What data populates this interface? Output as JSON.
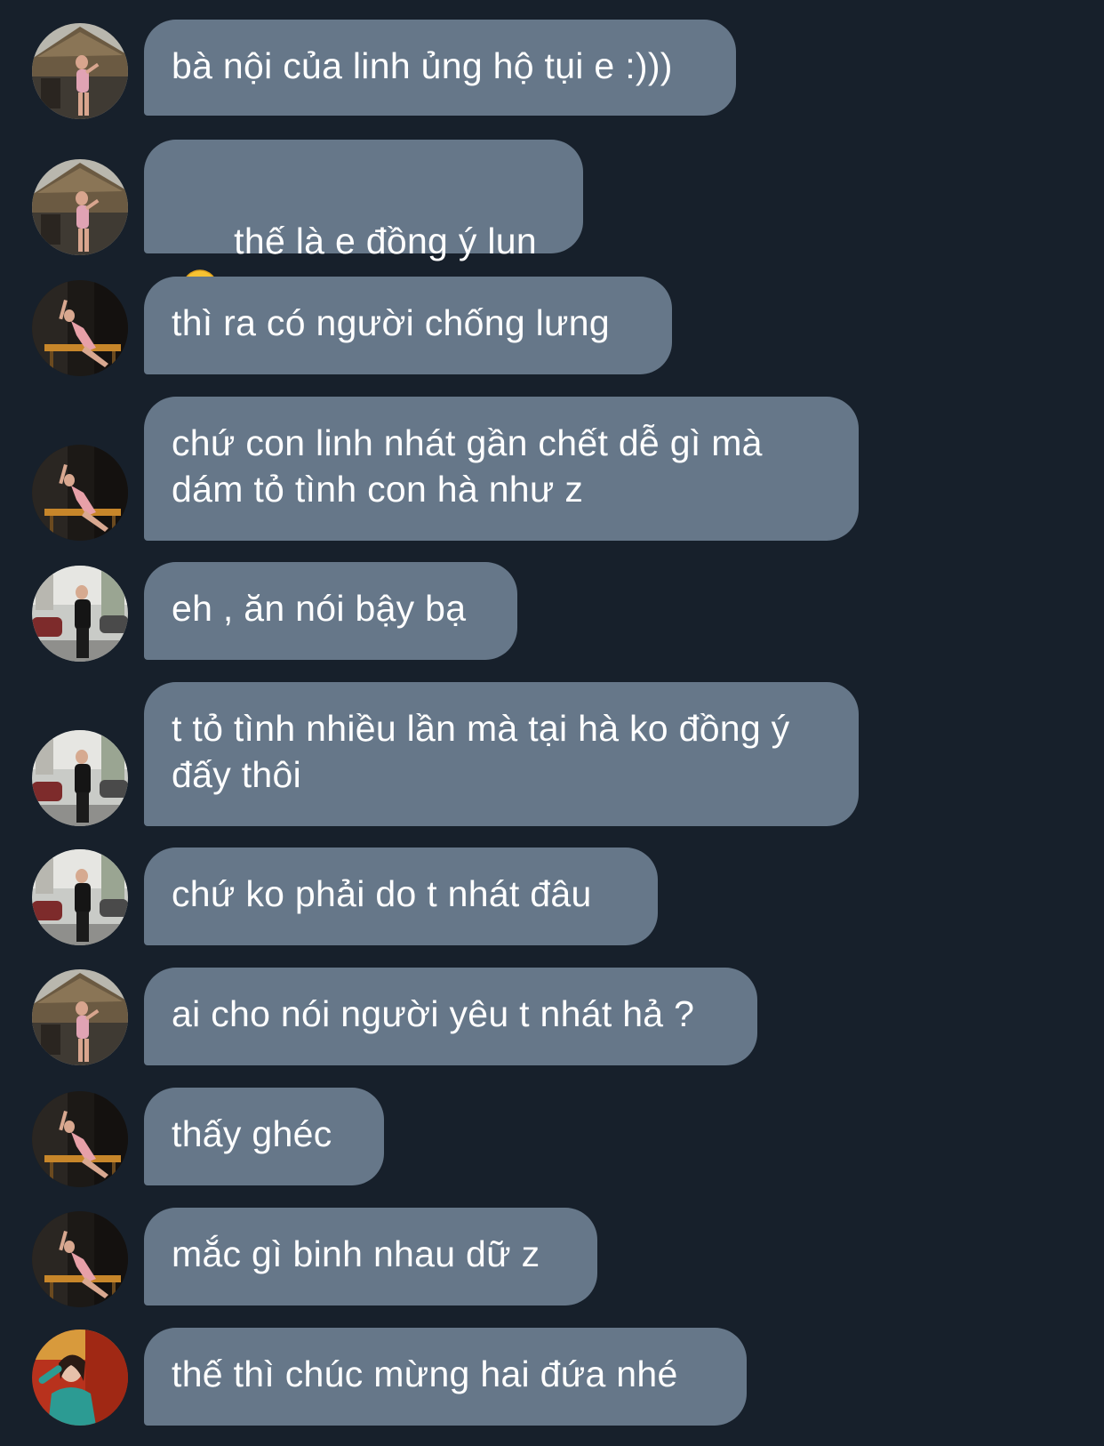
{
  "messages": [
    {
      "text": "bà nội của linh ủng hộ tụi e :)))",
      "avatar": "avatar-thatched-hut"
    },
    {
      "text": "thế là e đồng ý lun",
      "avatar": "avatar-thatched-hut",
      "emoji": "kissing-face-icon"
    },
    {
      "text": "thì ra có người chống lưng",
      "avatar": "avatar-dark-bench"
    },
    {
      "text": "chứ con linh nhát gần chết dễ gì mà\ndám tỏ tình con hà như z",
      "avatar": "avatar-dark-bench"
    },
    {
      "text": "eh , ăn nói bậy bạ",
      "avatar": "avatar-street"
    },
    {
      "text": "t tỏ tình nhiều lần mà tại hà ko đồng ý\nđấy thôi",
      "avatar": "avatar-street"
    },
    {
      "text": "chứ ko phải do t nhát đâu",
      "avatar": "avatar-street"
    },
    {
      "text": "ai cho nói người yêu t nhát hả ?",
      "avatar": "avatar-thatched-hut"
    },
    {
      "text": "thấy ghéc",
      "avatar": "avatar-dark-bench"
    },
    {
      "text": "mắc gì binh nhau dữ z",
      "avatar": "avatar-dark-bench"
    },
    {
      "text": "thế thì chúc mừng hai đứa nhé",
      "avatar": "avatar-red-wall"
    }
  ],
  "colors": {
    "background": "#17202b",
    "bubble": "#667789",
    "text": "#ffffff"
  }
}
